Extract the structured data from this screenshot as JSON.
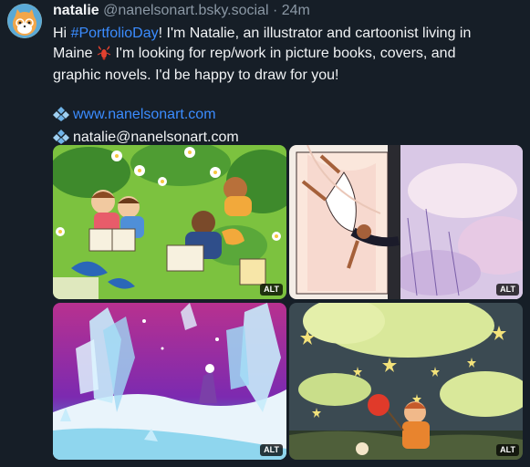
{
  "post": {
    "display_name": "natalie",
    "handle": "@nanelsonart.bsky.social",
    "separator": "·",
    "time": "24m",
    "text": {
      "hi": "Hi ",
      "hashtag": "#PortfolioDay",
      "intro": "! I'm Natalie, an illustrator and cartoonist living in",
      "maine": "Maine ",
      "after_lobster": " I'm looking for rep/work in picture books, covers, and",
      "line3": "graphic novels. I'd be happy to draw for you!",
      "website": "www.nanelsonart.com",
      "email": "natalie@nanelsonart.com"
    },
    "images": [
      {
        "description": "children reading in a leafy garden",
        "alt_badge": "ALT"
      },
      {
        "description": "girl falling through a window into clouds",
        "alt_badge": "ALT"
      },
      {
        "description": "figure walking through crystal landscape",
        "alt_badge": "ALT"
      },
      {
        "description": "boy with bindle under starry sky",
        "alt_badge": "ALT"
      }
    ]
  },
  "colors": {
    "background": "#161e27",
    "link": "#3b8cff",
    "muted": "#8b98a5"
  }
}
